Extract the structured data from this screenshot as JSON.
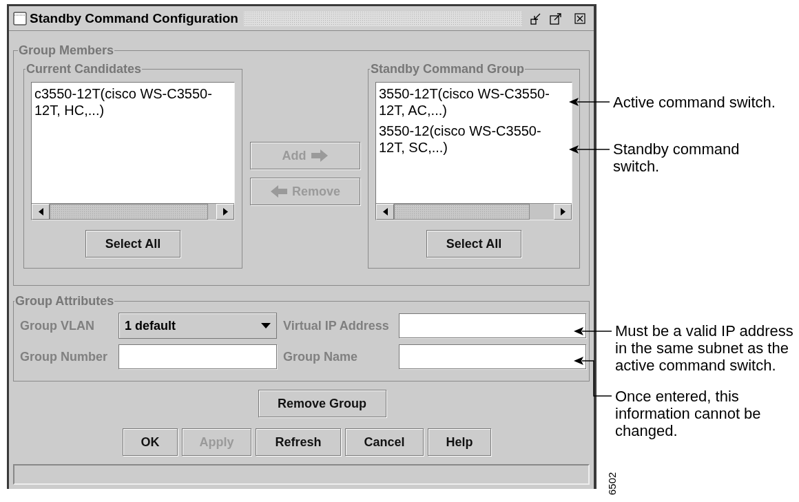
{
  "window": {
    "title": "Standby Command Configuration"
  },
  "group_members": {
    "title": "Group Members",
    "current_candidates": {
      "title": "Current Candidates",
      "items": [
        {
          "lines": [
            "c3550-12T(cisco WS-C3550-",
            "12T, HC,...)"
          ]
        }
      ],
      "select_all": "Select All"
    },
    "transfer_buttons": [
      {
        "label": "Add",
        "kind": "add",
        "disabled": true
      },
      {
        "label": "Remove",
        "kind": "remove",
        "disabled": true
      }
    ],
    "standby_command_group": {
      "title": "Standby Command Group",
      "items": [
        {
          "lines": [
            "3550-12T(cisco WS-C3550-",
            "12T, AC,...)"
          ]
        },
        {
          "lines": [
            "3550-12(cisco WS-C3550-",
            "12T, SC,...)"
          ]
        }
      ],
      "select_all": "Select All"
    }
  },
  "group_attributes": {
    "title": "Group Attributes",
    "fields": [
      {
        "label": "Group VLAN",
        "kind": "combo",
        "value": "1 default"
      },
      {
        "label": "Virtual IP Address",
        "kind": "text"
      },
      {
        "label": "Group Number",
        "kind": "text"
      },
      {
        "label": "Group Name",
        "kind": "text"
      }
    ]
  },
  "remove_group_button": {
    "label": "Remove Group",
    "disabled": false
  },
  "buttons": [
    {
      "label": "OK",
      "disabled": false
    },
    {
      "label": "Apply",
      "disabled": true
    },
    {
      "label": "Refresh",
      "disabled": false
    },
    {
      "label": "Cancel",
      "disabled": false
    },
    {
      "label": "Help",
      "disabled": false
    }
  ],
  "annotations": [
    {
      "text": "Active command switch."
    },
    {
      "text": "Standby command switch."
    },
    {
      "text": "Must be a valid IP address in the same subnet as the active command switch."
    },
    {
      "text": "Once entered, this information cannot be changed."
    }
  ],
  "figure_number": "6502"
}
